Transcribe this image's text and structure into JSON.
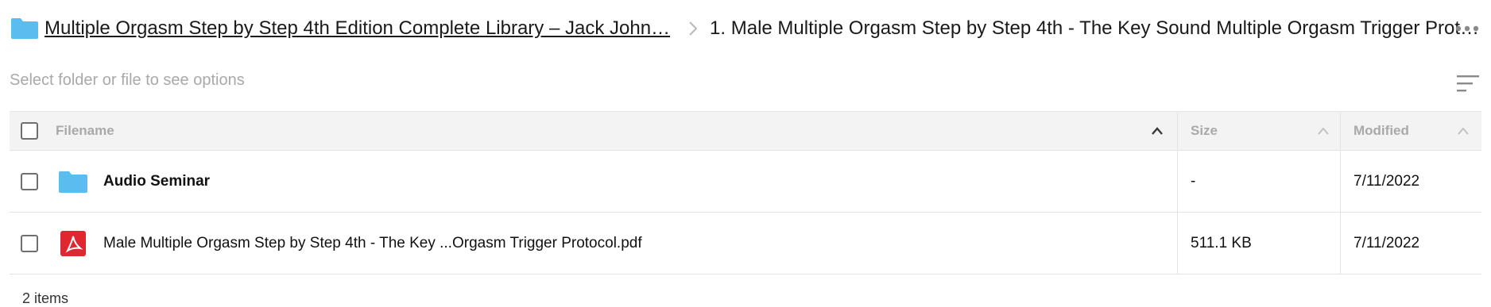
{
  "breadcrumb": {
    "root_label": "Multiple Orgasm Step by Step 4th Edition Complete Library – Jack John…",
    "current_label": "1. Male Multiple Orgasm Step by Step 4th - The Key Sound Multiple Orgasm Trigger Prot…",
    "root_icon": "folder-icon",
    "separator_icon": "chevron-right-icon",
    "more_icon": "more-horizontal-icon"
  },
  "toolbar": {
    "hint": "Select folder or file to see options",
    "sort_icon": "sort-lines-icon"
  },
  "table": {
    "columns": [
      {
        "label": "Filename",
        "sort_icon": "chevron-up-icon"
      },
      {
        "label": "Size",
        "sort_icon": "chevron-up-icon"
      },
      {
        "label": "Modified",
        "sort_icon": "chevron-up-icon"
      }
    ],
    "rows": [
      {
        "type": "folder",
        "icon": "folder-icon",
        "name": "Audio Seminar",
        "size": "-",
        "modified": "7/11/2022"
      },
      {
        "type": "pdf",
        "icon": "pdf-icon",
        "name": "Male Multiple Orgasm Step by Step 4th - The Key ...Orgasm Trigger Protocol.pdf",
        "size": "511.1 KB",
        "modified": "7/11/2022"
      }
    ]
  },
  "footer": {
    "count": "2 items"
  },
  "colors": {
    "folder": "#5bbcf0",
    "pdf": "#e0262e",
    "header_bg": "#f3f3f3",
    "border": "#e4e4e4",
    "muted_text": "#a9a9a9"
  }
}
